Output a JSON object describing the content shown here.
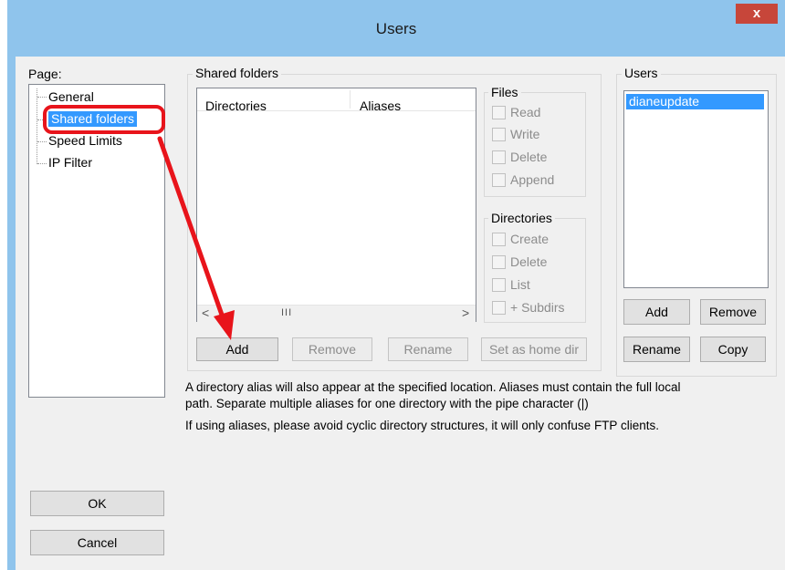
{
  "window": {
    "title": "Users",
    "close_label": "x"
  },
  "page_panel": {
    "label": "Page:",
    "items": [
      "General",
      "Shared folders",
      "Speed Limits",
      "IP Filter"
    ]
  },
  "shared_folders": {
    "group_label": "Shared folders",
    "columns": [
      "Directories",
      "Aliases"
    ],
    "scroll_glyph": "III",
    "buttons": {
      "add": "Add",
      "remove": "Remove",
      "rename": "Rename",
      "home": "Set as home dir"
    }
  },
  "files": {
    "label": "Files",
    "options": [
      "Read",
      "Write",
      "Delete",
      "Append"
    ]
  },
  "directories": {
    "label": "Directories",
    "options": [
      "Create",
      "Delete",
      "List",
      "+ Subdirs"
    ]
  },
  "users": {
    "label": "Users",
    "list": [
      "dianeupdate"
    ],
    "buttons": {
      "add": "Add",
      "remove": "Remove",
      "rename": "Rename",
      "copy": "Copy"
    }
  },
  "info": {
    "line1": "A directory alias will also appear at the specified location. Aliases must contain the full local",
    "line2": "path. Separate multiple aliases for one directory with the pipe character (|)",
    "line3": "If using aliases, please avoid cyclic directory structures, it will only confuse FTP clients."
  },
  "dialog_buttons": {
    "ok": "OK",
    "cancel": "Cancel"
  },
  "colors": {
    "selection": "#3399ff",
    "annotation": "#e8141b",
    "title_bar": "#8fc4ec"
  }
}
